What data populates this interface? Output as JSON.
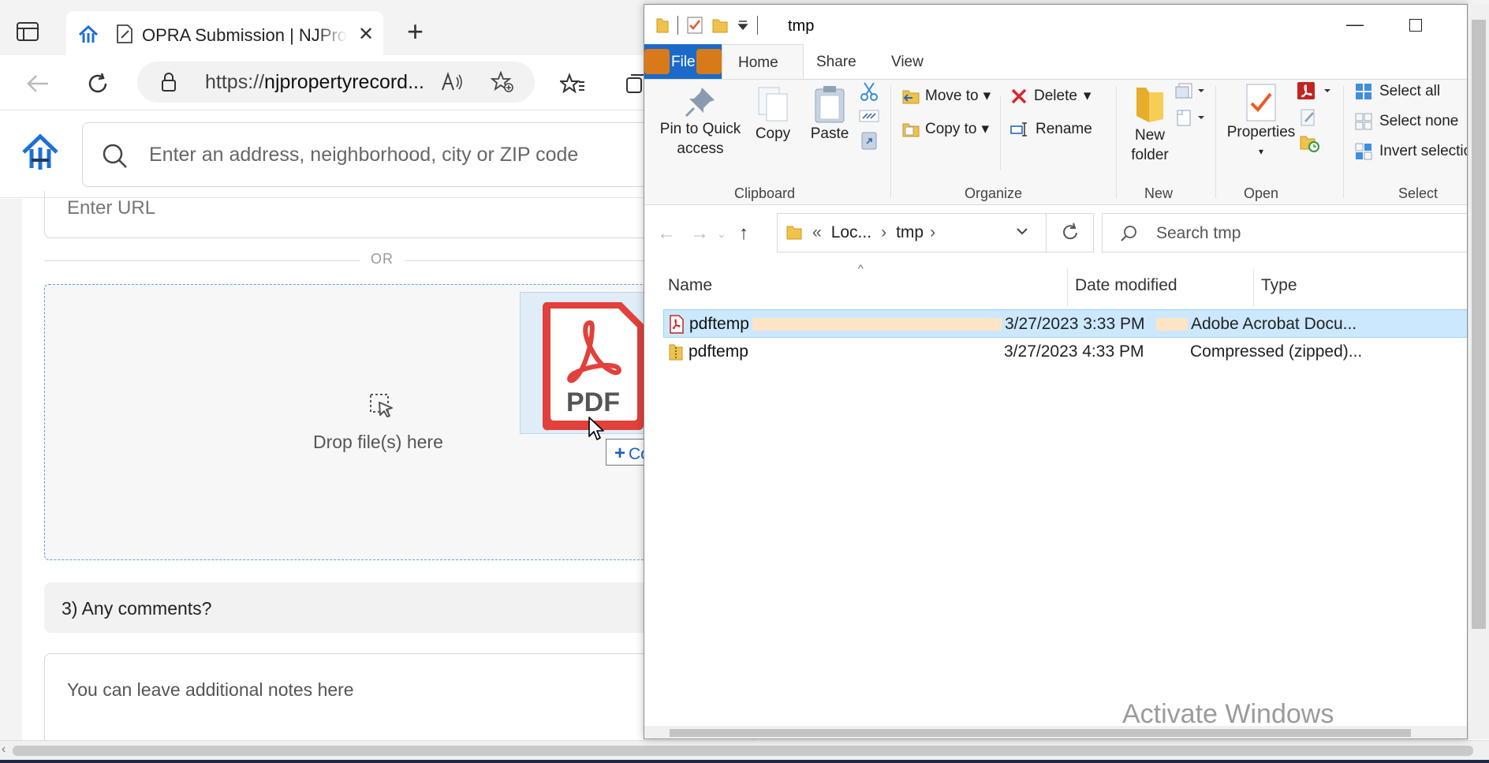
{
  "browser": {
    "tab": {
      "title": "OPRA Submission | NJProperty",
      "close": "✕"
    },
    "new_tab": "+",
    "address": {
      "url_prefix": "https://",
      "url_host": "njpropertyrecord..."
    },
    "search": {
      "placeholder": "Enter an address, neighborhood, city or ZIP code"
    },
    "form": {
      "url_placeholder": "Enter URL",
      "or_text": "OR",
      "drop_text": "Drop file(s) here",
      "question3": "3) Any comments?",
      "notes_placeholder": "You can leave additional notes here"
    },
    "colors": {
      "accent": "#1b6ac9",
      "dropzone_border": "#5aa4dc"
    }
  },
  "drag": {
    "pdf_label": "PDF",
    "copy_tooltip": "Copy",
    "copy_symbol": "+",
    "pdf_color": "#e1403b"
  },
  "explorer": {
    "title": "tmp",
    "ribbon_tabs": {
      "file": "File",
      "home": "Home",
      "share": "Share",
      "view": "View"
    },
    "clipboard": {
      "pin_line1": "Pin to Quick",
      "pin_line2": "access",
      "copy": "Copy",
      "paste": "Paste",
      "label": "Clipboard"
    },
    "organize": {
      "move_to": "Move to",
      "copy_to": "Copy to",
      "delete": "Delete",
      "rename": "Rename",
      "label": "Organize"
    },
    "new": {
      "line1": "New",
      "line2": "folder",
      "label": "New"
    },
    "open": {
      "properties": "Properties",
      "label": "Open"
    },
    "select": {
      "select_all": "Select all",
      "select_none": "Select none",
      "invert": "Invert selection",
      "label": "Select"
    },
    "path": {
      "prefix": "«",
      "crumb1": "Loc...",
      "crumb2": "tmp"
    },
    "search": {
      "placeholder": "Search tmp"
    },
    "columns": {
      "name": "Name",
      "date": "Date modified",
      "type": "Type"
    },
    "files": [
      {
        "name": "pdftemp",
        "date": "3/27/2023 3:33 PM",
        "type": "Adobe Acrobat Docu..."
      },
      {
        "name": "pdftemp",
        "date": "3/27/2023 4:33 PM",
        "type": "Compressed (zipped)..."
      }
    ],
    "watermark": "Activate Windows"
  }
}
